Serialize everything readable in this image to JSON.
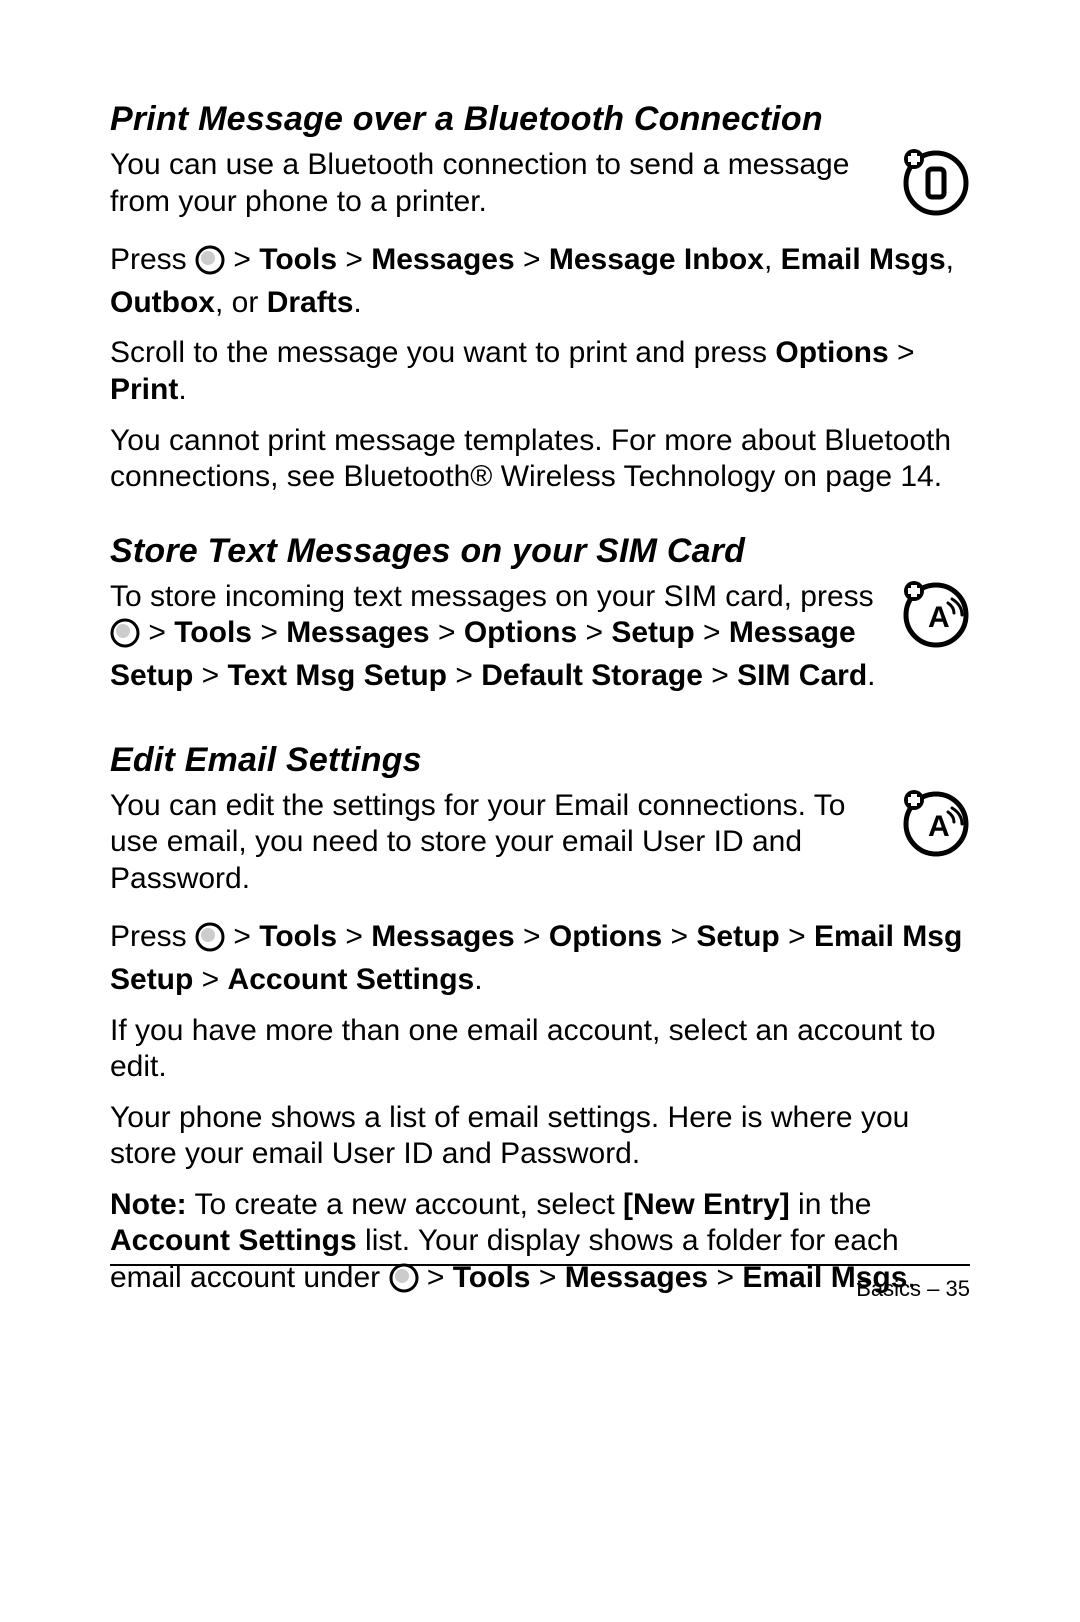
{
  "section1": {
    "heading": "Print Message over a Bluetooth Connection",
    "p1": "You can use a Bluetooth connection to send a message from your phone to a printer.",
    "p2_a": "Press ",
    "p2_b": " > ",
    "p2_tools": "Tools",
    "p2_c": " > ",
    "p2_messages": "Messages",
    "p2_d": " > ",
    "p2_inbox": "Message Inbox",
    "p2_e": ", ",
    "p2_email": "Email Msgs",
    "p2_f": ", ",
    "p2_outbox": "Outbox",
    "p2_g": ", or ",
    "p2_drafts": "Drafts",
    "p2_h": ".",
    "p3_a": "Scroll to the message you want to print and press ",
    "p3_options": "Options",
    "p3_b": " > ",
    "p3_print": "Print",
    "p3_c": ".",
    "p4": "You cannot print message templates. For more about Bluetooth connections, see Bluetooth® Wireless Technology on page 14."
  },
  "section2": {
    "heading": "Store Text Messages on your SIM Card",
    "p1_a": "To store incoming text messages on your SIM card, press ",
    "p1_b": " > ",
    "p1_tools": "Tools",
    "p1_c": " > ",
    "p1_messages": "Messages",
    "p1_d": " > ",
    "p1_options": "Options",
    "p1_e": " > ",
    "p1_setup": "Setup",
    "p1_f": " > ",
    "p1_msgsetup": "Message Setup",
    "p1_g": " > ",
    "p1_txtsetup": "Text Msg Setup",
    "p1_h": " > ",
    "p1_defstore": "Default Storage",
    "p1_i": " > ",
    "p1_sim": "SIM Card",
    "p1_j": "."
  },
  "section3": {
    "heading": "Edit Email Settings",
    "p1": "You can edit the settings for your Email connections. To use email, you need to store your email User ID and Password.",
    "p2_a": "Press ",
    "p2_b": " > ",
    "p2_tools": "Tools",
    "p2_c": " > ",
    "p2_messages": "Messages",
    "p2_d": " > ",
    "p2_options": "Options",
    "p2_e": " > ",
    "p2_setup": "Setup",
    "p2_f": " > ",
    "p2_emailsetup": "Email Msg Setup",
    "p2_g": " > ",
    "p2_account": "Account Settings",
    "p2_h": ".",
    "p3": "If you have more than one email account, select an account to edit.",
    "p4": "Your phone shows a list of email settings. Here is where you store your email User ID and Password.",
    "p5_note": "Note:",
    "p5_a": " To create a new account, select ",
    "p5_newentry": "[New Entry]",
    "p5_b": " in the ",
    "p5_acct": "Account Settings",
    "p5_c": " list. Your display shows a folder for each email account under ",
    "p5_d": " > ",
    "p5_tools": "Tools",
    "p5_e": " > ",
    "p5_messages": "Messages",
    "p5_f": " > ",
    "p5_emailmsgs": "Email Msgs",
    "p5_g": "."
  },
  "footer": {
    "section": "Basics",
    "sep": " – ",
    "page": "35"
  }
}
